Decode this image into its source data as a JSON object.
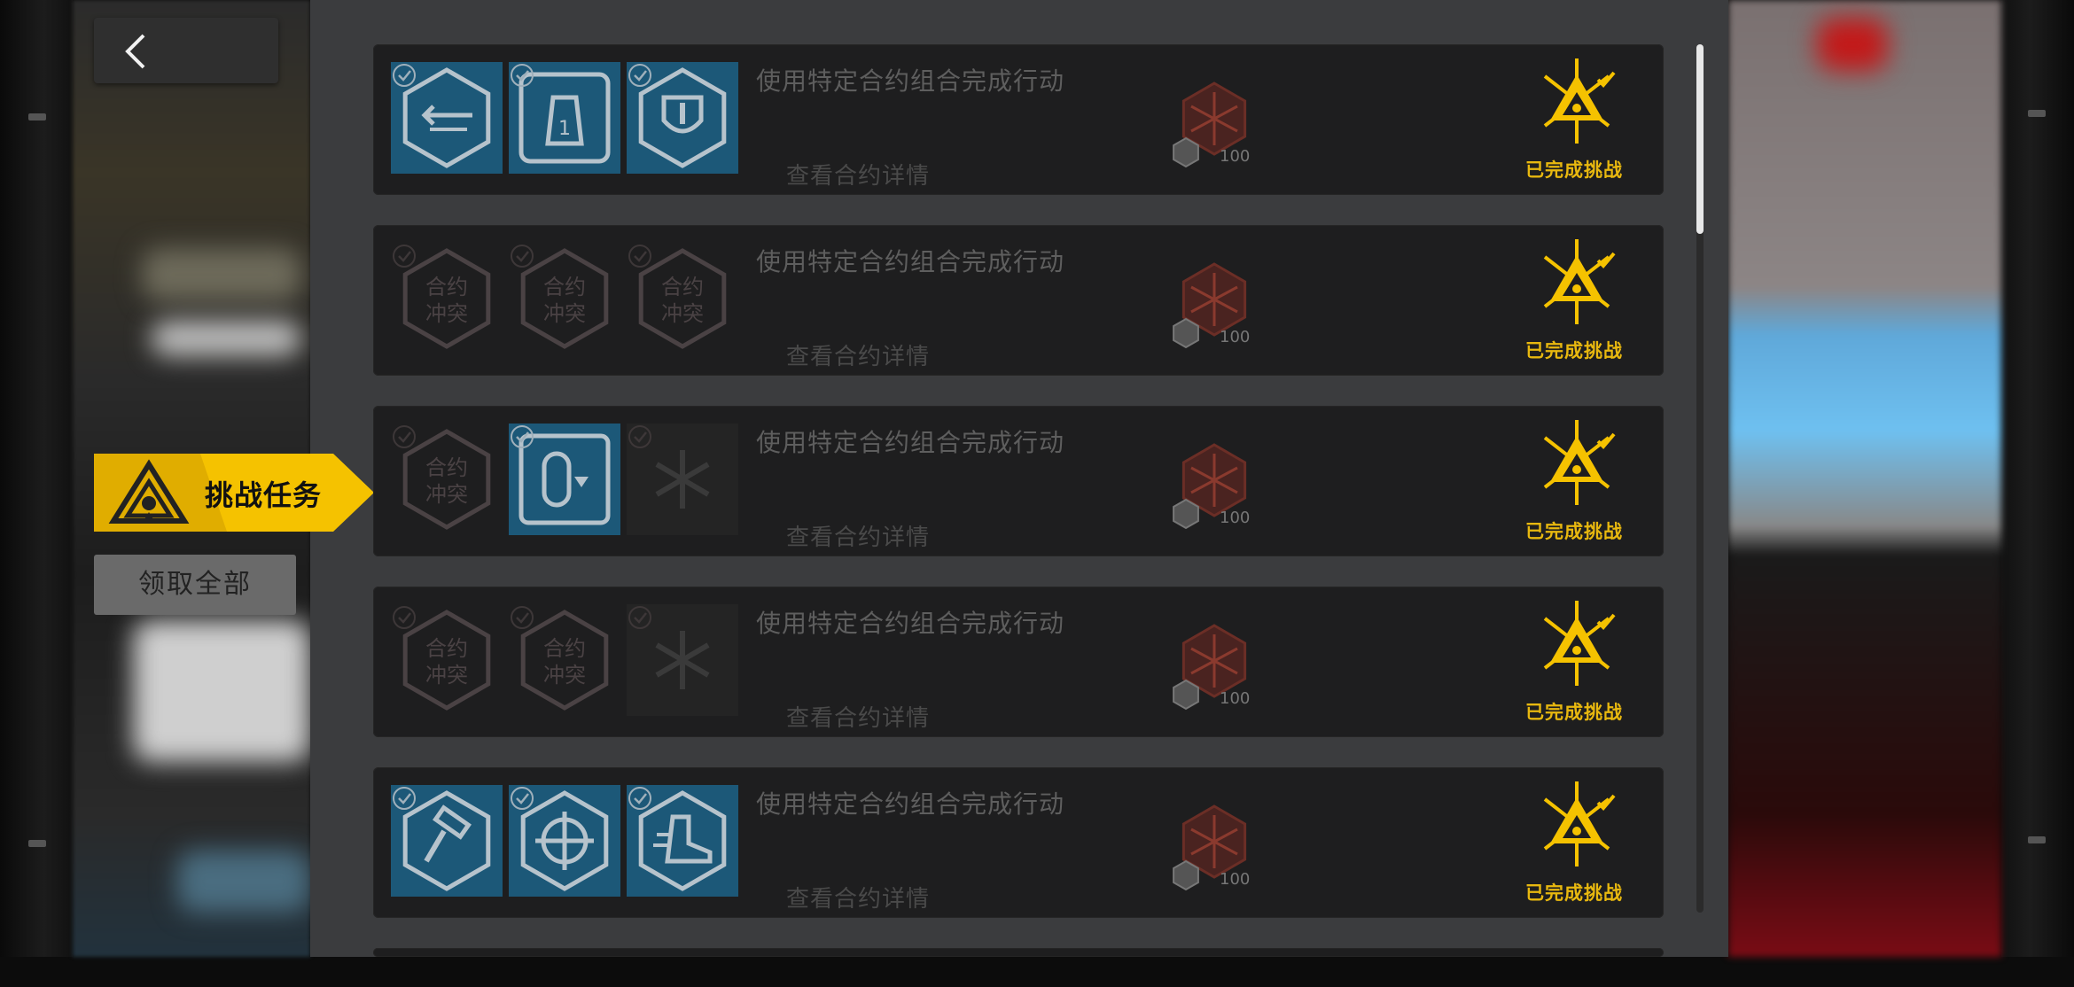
{
  "header": {
    "back_icon": "chevron-left-icon"
  },
  "sidebar": {
    "challenge_tab_label": "挑战任务",
    "challenge_tab_icon": "triangle-emblem-icon",
    "claim_all_label": "领取全部",
    "accent_color": "#f5c200"
  },
  "missions": [
    {
      "description": "使用特定合约组合完成行动",
      "detail_link": "查看合约详情",
      "reward_amount": "100",
      "status": "已完成挑战",
      "contracts": [
        {
          "icon": "arrows-icon",
          "style": "blue",
          "checked": true
        },
        {
          "icon": "rank-1-icon",
          "style": "blue",
          "checked": true
        },
        {
          "icon": "shield-icon",
          "style": "blue",
          "checked": true
        }
      ]
    },
    {
      "description": "使用特定合约组合完成行动",
      "detail_link": "查看合约详情",
      "reward_amount": "100",
      "status": "已完成挑战",
      "contracts": [
        {
          "icon": "contract-conflict-icon",
          "label": "合约冲突",
          "style": "dim",
          "checked": false
        },
        {
          "icon": "contract-conflict-icon",
          "label": "合约冲突",
          "style": "dim",
          "checked": false
        },
        {
          "icon": "contract-conflict-icon",
          "label": "合约冲突",
          "style": "dim",
          "checked": false
        }
      ]
    },
    {
      "description": "使用特定合约组合完成行动",
      "detail_link": "查看合约详情",
      "reward_amount": "100",
      "status": "已完成挑战",
      "contracts": [
        {
          "icon": "contract-conflict-icon",
          "label": "合约冲突",
          "style": "dim",
          "checked": false
        },
        {
          "icon": "timer-icon",
          "style": "blue",
          "checked": true
        },
        {
          "icon": "snowflake-icon",
          "style": "dark",
          "checked": false
        }
      ]
    },
    {
      "description": "使用特定合约组合完成行动",
      "detail_link": "查看合约详情",
      "reward_amount": "100",
      "status": "已完成挑战",
      "contracts": [
        {
          "icon": "contract-conflict-icon",
          "label": "合约冲突",
          "style": "dim",
          "checked": false
        },
        {
          "icon": "contract-conflict-icon",
          "label": "合约冲突",
          "style": "dim",
          "checked": false
        },
        {
          "icon": "snowflake-icon",
          "style": "dark",
          "checked": false
        }
      ]
    },
    {
      "description": "使用特定合约组合完成行动",
      "detail_link": "查看合约详情",
      "reward_amount": "100",
      "status": "已完成挑战",
      "contracts": [
        {
          "icon": "hammer-icon",
          "style": "blue",
          "checked": true
        },
        {
          "icon": "crosshair-icon",
          "style": "blue",
          "checked": true
        },
        {
          "icon": "boot-icon",
          "style": "blue",
          "checked": true
        }
      ]
    }
  ]
}
